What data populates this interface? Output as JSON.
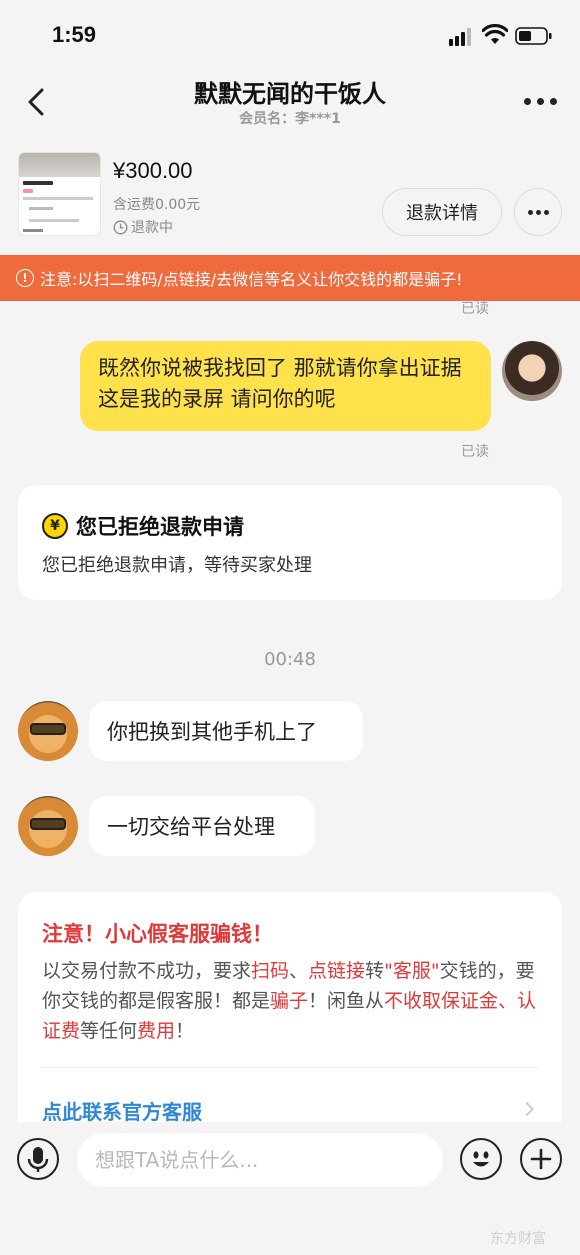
{
  "status_bar": {
    "time": "1:59"
  },
  "header": {
    "title": "默默无闻的干饭人",
    "subtitle": "会员名：李***1"
  },
  "order": {
    "price": "¥300.00",
    "shipping": "含运费0.00元",
    "status": "退款中",
    "refund_button": "退款详情"
  },
  "warning_banner": "注意:以扫二维码/点链接/去微信等名义让你交钱的都是骗子!",
  "messages": {
    "read_top": "已读",
    "my_message": "既然你说被我找回了 那就请你拿出证据 这是我的录屏 请问你的呢",
    "read_after": "已读",
    "system_title": "您已拒绝退款申请",
    "system_desc": "您已拒绝退款申请，等待买家处理",
    "timestamp": "00:48",
    "buyer_msg_1": "你把换到其他手机上了",
    "buyer_msg_2": "一切交给平台处理"
  },
  "notice": {
    "title": "注意！小心假客服骗钱！",
    "p1": "以交易付款不成功，要求",
    "r1": "扫码",
    "p2": "、",
    "r2": "点链接",
    "p3": "转",
    "r3": "\"客服\"",
    "p4": "交钱的，要你交钱的都是假客服！都是",
    "r4": "骗子",
    "p5": "！闲鱼从",
    "r5": "不收取保证金、认证费",
    "p6": "等任何",
    "r6": "费用",
    "p7": "！",
    "link": "点此联系官方客服"
  },
  "input": {
    "placeholder": "想跟TA说点什么..."
  },
  "watermark": "东方财富",
  "colors": {
    "warning_bg": "#ef6a3c",
    "my_bubble": "#ffe14c",
    "notice_red": "#e1393a",
    "link_blue": "#2f87d6"
  },
  "icons": [
    "back-arrow-icon",
    "more-dots-icon",
    "clock-icon",
    "warning-circle-icon",
    "coin-icon",
    "voice-icon",
    "emoji-icon",
    "plus-icon",
    "chevron-right-icon"
  ]
}
